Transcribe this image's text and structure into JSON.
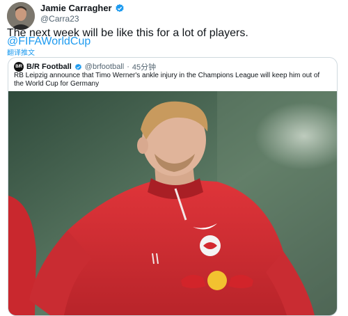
{
  "tweet": {
    "author_name": "Jamie Carragher",
    "author_handle": "@Carra23",
    "text": "The next week will be like this for a lot of players.",
    "hashtag": "@FIFAWorldCup",
    "translate_label": "翻译推文"
  },
  "quoted": {
    "avatar_label": "B/R",
    "author_name": "B/R Football",
    "author_handle": "@brfootball",
    "separator": "·",
    "time": "45分钟",
    "text": "RB Leipzig announce that Timo Werner's ankle injury in the Champions League will keep him out of the World Cup for Germany"
  },
  "colors": {
    "link": "#1d9bf0",
    "verified": "#1d9bf0",
    "jersey": "#d92b31"
  }
}
